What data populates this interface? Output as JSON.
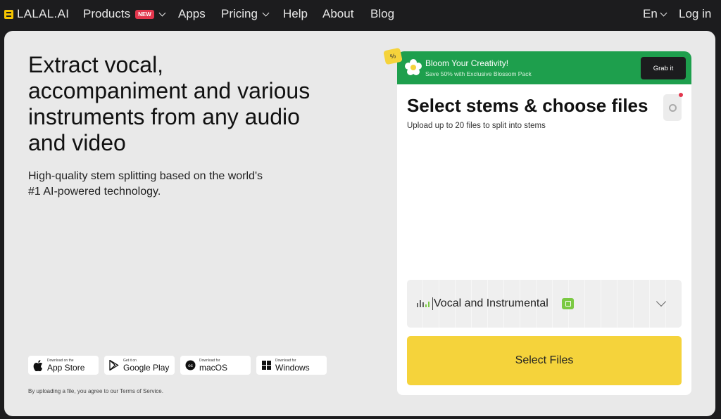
{
  "nav": {
    "logo_text": "LALAL.AI",
    "products": "Products",
    "new_badge": "NEW",
    "apps": "Apps",
    "pricing": "Pricing",
    "help": "Help",
    "about": "About",
    "blog": "Blog",
    "language": "En",
    "login": "Log in"
  },
  "hero": {
    "title": "Extract vocal, accompaniment and various instruments from any audio and video",
    "subtitle": "High-quality stem splitting based on the world's #1 AI-powered technology."
  },
  "stores": [
    {
      "small": "Download on the",
      "big": "App Store",
      "icon": "apple-icon"
    },
    {
      "small": "Get it on",
      "big": "Google Play",
      "icon": "google-play-icon"
    },
    {
      "small": "Download for",
      "big": "macOS",
      "icon": "macos-icon"
    },
    {
      "small": "Download for",
      "big": "Windows",
      "icon": "windows-icon"
    }
  ],
  "terms": "By uploading a file, you agree to our Terms of Service.",
  "promo": {
    "tag": "%",
    "title": "Bloom Your Creativity!",
    "subtitle": "Save 50% with Exclusive Blossom Pack",
    "button": "Grab it",
    "color": "#1e9f4d"
  },
  "card": {
    "title": "Select stems & choose files",
    "subtitle": "Upload up to 20 files to split into stems",
    "stem_select": "Vocal and Instrumental",
    "select_button": "Select Files",
    "accent": "#f5d33b"
  }
}
